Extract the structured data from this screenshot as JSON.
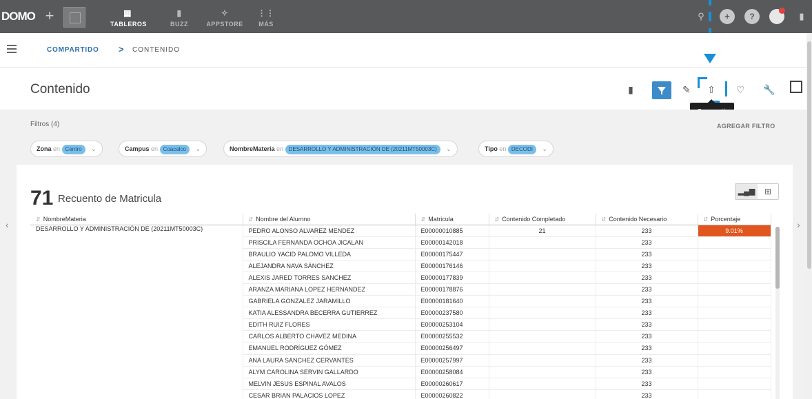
{
  "topbar": {
    "logo": "DOMO",
    "plus": "+",
    "nav": [
      {
        "label": "TABLEROS",
        "icon": "dashboard-icon",
        "active": true
      },
      {
        "label": "BUZZ",
        "icon": "chat-icon",
        "active": false
      },
      {
        "label": "APPSTORE",
        "icon": "appstore-icon",
        "active": false
      },
      {
        "label": "MÁS",
        "icon": "grid-icon",
        "active": false
      }
    ]
  },
  "breadcrumb": {
    "parent": "COMPARTIDO",
    "separator": ">",
    "current": "CONTENIDO"
  },
  "page": {
    "title": "Contenido",
    "tooltip": "Compartir"
  },
  "filters": {
    "count_label": "Filtros (4)",
    "add_label": "AGREGAR FILTRO",
    "items": [
      {
        "key": "Zona",
        "op": "en",
        "value": "Centro"
      },
      {
        "key": "Campus",
        "op": "en",
        "value": "Coacalco"
      },
      {
        "key": "NombreMateria",
        "op": "en",
        "value": "DESARROLLO Y ADMINISTRACIÓN DE (20211MT50003C)"
      },
      {
        "key": "Tipo",
        "op": "en",
        "value": "DECODI"
      }
    ]
  },
  "card": {
    "big_number": "71",
    "title": "Recuento de Matricula"
  },
  "table": {
    "headers": [
      "NombreMateria",
      "Nombre del Alumno",
      "Matricula",
      "Contenido Completado",
      "Contenido Necesario",
      "Porcentaje"
    ],
    "materia": "DESARROLLO Y ADMINISTRACIÓN DE (20211MT50003C)",
    "rows": [
      {
        "alumno": "PEDRO ALONSO ALVAREZ MENDEZ",
        "matricula": "E00000010885",
        "completado": "21",
        "necesario": "233",
        "porcentaje": "9.01%"
      },
      {
        "alumno": "PRISCILA  FERNANDA OCHOA JICALAN",
        "matricula": "E00000142018",
        "completado": "",
        "necesario": "233",
        "porcentaje": ""
      },
      {
        "alumno": "BRAULIO YACID PALOMO VILLEDA",
        "matricula": "E00000175447",
        "completado": "",
        "necesario": "233",
        "porcentaje": ""
      },
      {
        "alumno": "ALEJANDRA NAVA SÁNCHEZ",
        "matricula": "E00000176146",
        "completado": "",
        "necesario": "233",
        "porcentaje": ""
      },
      {
        "alumno": "ALEXIS JARED TORRES SANCHEZ",
        "matricula": "E00000177839",
        "completado": "",
        "necesario": "233",
        "porcentaje": ""
      },
      {
        "alumno": "ARANZA MARIANA LOPEZ HERNANDEZ",
        "matricula": "E00000178876",
        "completado": "",
        "necesario": "233",
        "porcentaje": ""
      },
      {
        "alumno": "GABRIELA GONZALEZ JARAMILLO",
        "matricula": "E00000181640",
        "completado": "",
        "necesario": "233",
        "porcentaje": ""
      },
      {
        "alumno": "KATIA ALESSANDRA BECERRA GUTIERREZ",
        "matricula": "E00000237580",
        "completado": "",
        "necesario": "233",
        "porcentaje": ""
      },
      {
        "alumno": "EDITH RUIZ FLORES",
        "matricula": "E00000253104",
        "completado": "",
        "necesario": "233",
        "porcentaje": ""
      },
      {
        "alumno": "CARLOS ALBERTO CHAVEZ MEDINA",
        "matricula": "E00000255532",
        "completado": "",
        "necesario": "233",
        "porcentaje": ""
      },
      {
        "alumno": "EMANUEL RODRÍGUEZ GÓMEZ",
        "matricula": "E00000256497",
        "completado": "",
        "necesario": "233",
        "porcentaje": ""
      },
      {
        "alumno": "ANA LAURA SANCHEZ CERVANTES",
        "matricula": "E00000257997",
        "completado": "",
        "necesario": "233",
        "porcentaje": ""
      },
      {
        "alumno": "ALYM CAROLINA SERVIN GALLARDO",
        "matricula": "E00000258084",
        "completado": "",
        "necesario": "233",
        "porcentaje": ""
      },
      {
        "alumno": "MELVIN JESUS ESPINAL AVALOS",
        "matricula": "E00000260617",
        "completado": "",
        "necesario": "233",
        "porcentaje": ""
      },
      {
        "alumno": "CESAR BRIAN PALACIOS LOPEZ",
        "matricula": "E00000260822",
        "completado": "",
        "necesario": "233",
        "porcentaje": ""
      }
    ]
  },
  "colors": {
    "accent": "#3d8bc9",
    "annotation": "#1a8fd9",
    "percent_cell": "#e0561e",
    "topbar": "#58595b"
  }
}
